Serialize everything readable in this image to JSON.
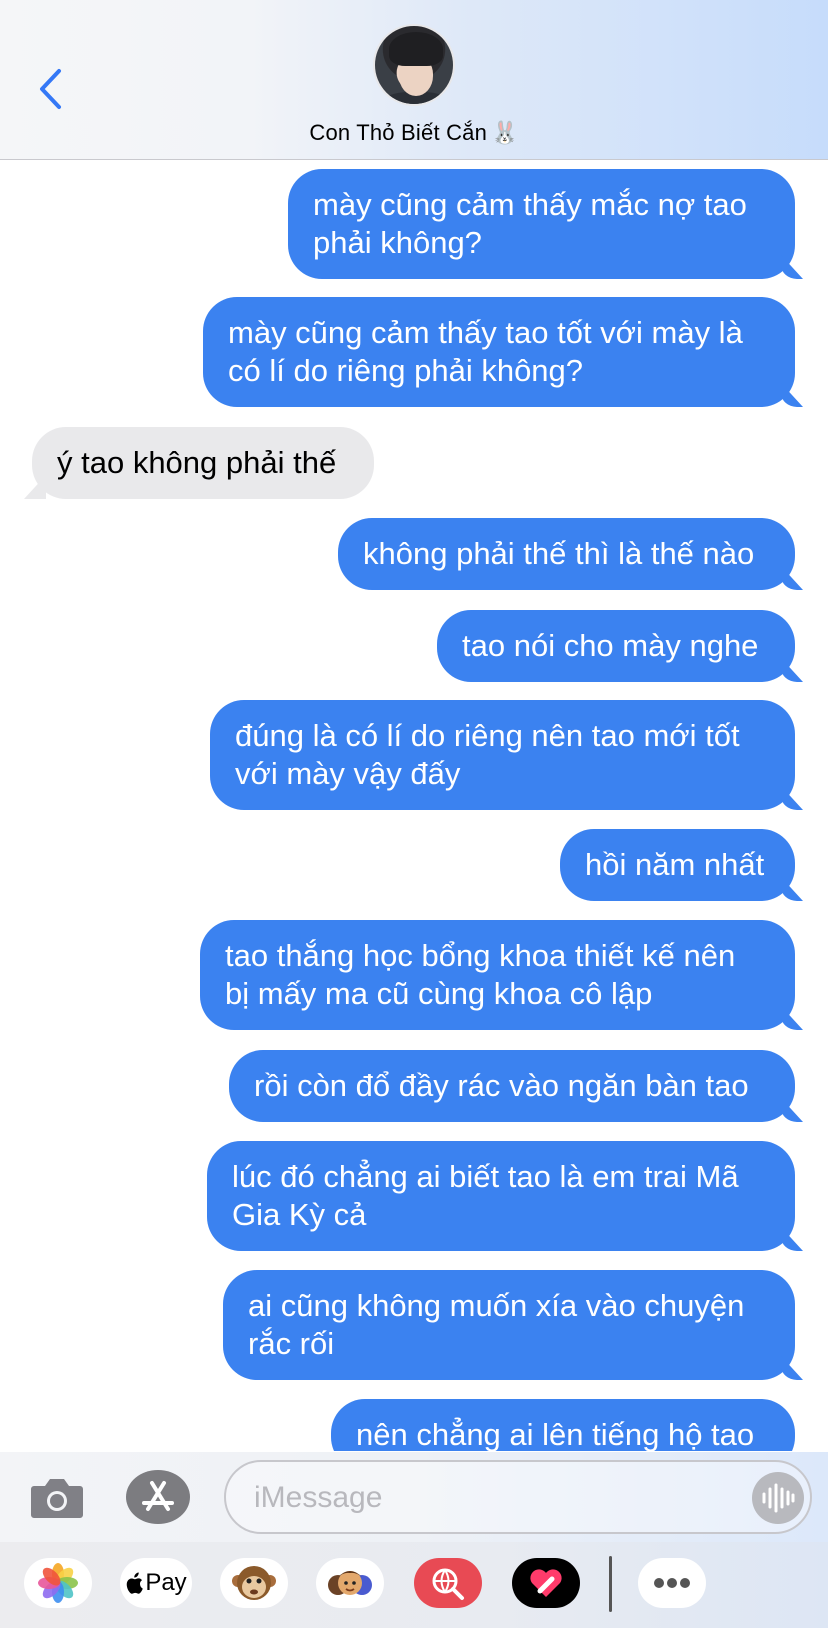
{
  "header": {
    "contact_name": "Con Thỏ Biết Cắn",
    "contact_emoji": "🐰"
  },
  "messages": [
    {
      "side": "sent",
      "text": "mày cũng cảm thấy mắc nợ tao\nphải không?"
    },
    {
      "side": "sent",
      "text": "mày cũng cảm thấy tao tốt với mày là\ncó lí do riêng phải không?"
    },
    {
      "side": "received",
      "text": "ý tao không phải thế"
    },
    {
      "side": "sent",
      "text": "không phải thế thì là thế nào"
    },
    {
      "side": "sent",
      "text": "tao nói cho mày nghe"
    },
    {
      "side": "sent",
      "text": "đúng là có lí do riêng nên tao mới tốt\nvới mày vậy đấy"
    },
    {
      "side": "sent",
      "text": "hồi năm nhất"
    },
    {
      "side": "sent",
      "text": "tao thắng học bổng khoa thiết kế nên\nbị mấy ma cũ cùng khoa cô lập"
    },
    {
      "side": "sent",
      "text": "rồi còn đổ đầy rác vào ngăn bàn tao"
    },
    {
      "side": "sent",
      "text": "lúc đó chẳng ai biết tao là em trai Mã\nGia Kỳ cả"
    },
    {
      "side": "sent",
      "text": "ai cũng không muốn xía vào chuyện\nrắc rối"
    },
    {
      "side": "sent",
      "text": "nên chẳng ai lên tiếng hộ tao"
    }
  ],
  "input": {
    "placeholder": "iMessage"
  },
  "app_drawer": {
    "apple_pay_label": "Pay",
    "icons": [
      "photos-icon",
      "apple-pay-icon",
      "animoji-icon",
      "memoji-icon",
      "web-search-icon",
      "digital-touch-icon",
      "more-icon"
    ]
  },
  "colors": {
    "sent_bubble": "#3b82f0",
    "received_bubble": "#e9e9eb",
    "accent": "#3478f6"
  }
}
